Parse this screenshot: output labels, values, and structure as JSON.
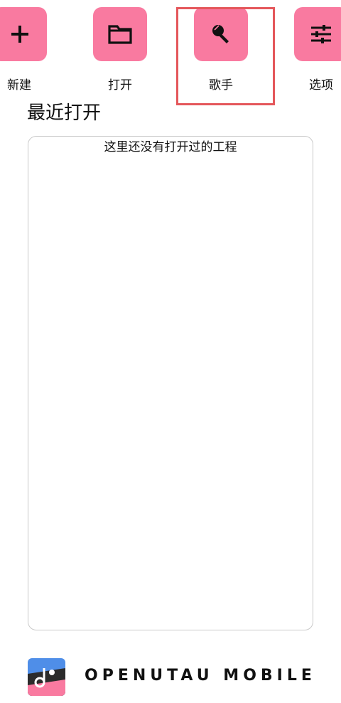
{
  "actions": [
    {
      "id": "new",
      "label": "新建",
      "icon": "plus-icon"
    },
    {
      "id": "open",
      "label": "打开",
      "icon": "folder-icon"
    },
    {
      "id": "singers",
      "label": "歌手",
      "icon": "microphone-icon"
    },
    {
      "id": "options",
      "label": "选项",
      "icon": "sliders-icon"
    }
  ],
  "recent": {
    "title": "最近打开",
    "empty_text": "这里还没有打开过的工程"
  },
  "brand": {
    "name": "OPENUTAU MOBILE",
    "logo_icon": "openutau-logo"
  },
  "colors": {
    "accent": "#f97aa0",
    "highlight": "#e4575b",
    "border": "#c9c9c9"
  }
}
